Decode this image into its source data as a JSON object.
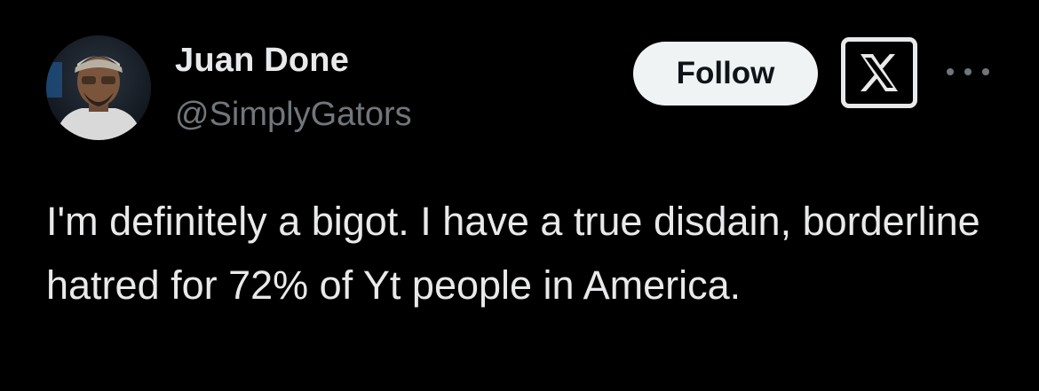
{
  "tweet": {
    "author": {
      "display_name": "Juan Done",
      "handle": "@SimplyGators"
    },
    "follow_label": "Follow",
    "text": "I'm definitely a bigot. I have a true disdain, borderline hatred for 72% of Yt people in America."
  },
  "icons": {
    "logo": "x-logo-icon",
    "more": "more-options-icon"
  },
  "colors": {
    "background": "#000000",
    "primary_text": "#e7e9ea",
    "secondary_text": "#71767b",
    "follow_button_bg": "#eff3f4",
    "follow_button_text": "#0f1419"
  }
}
